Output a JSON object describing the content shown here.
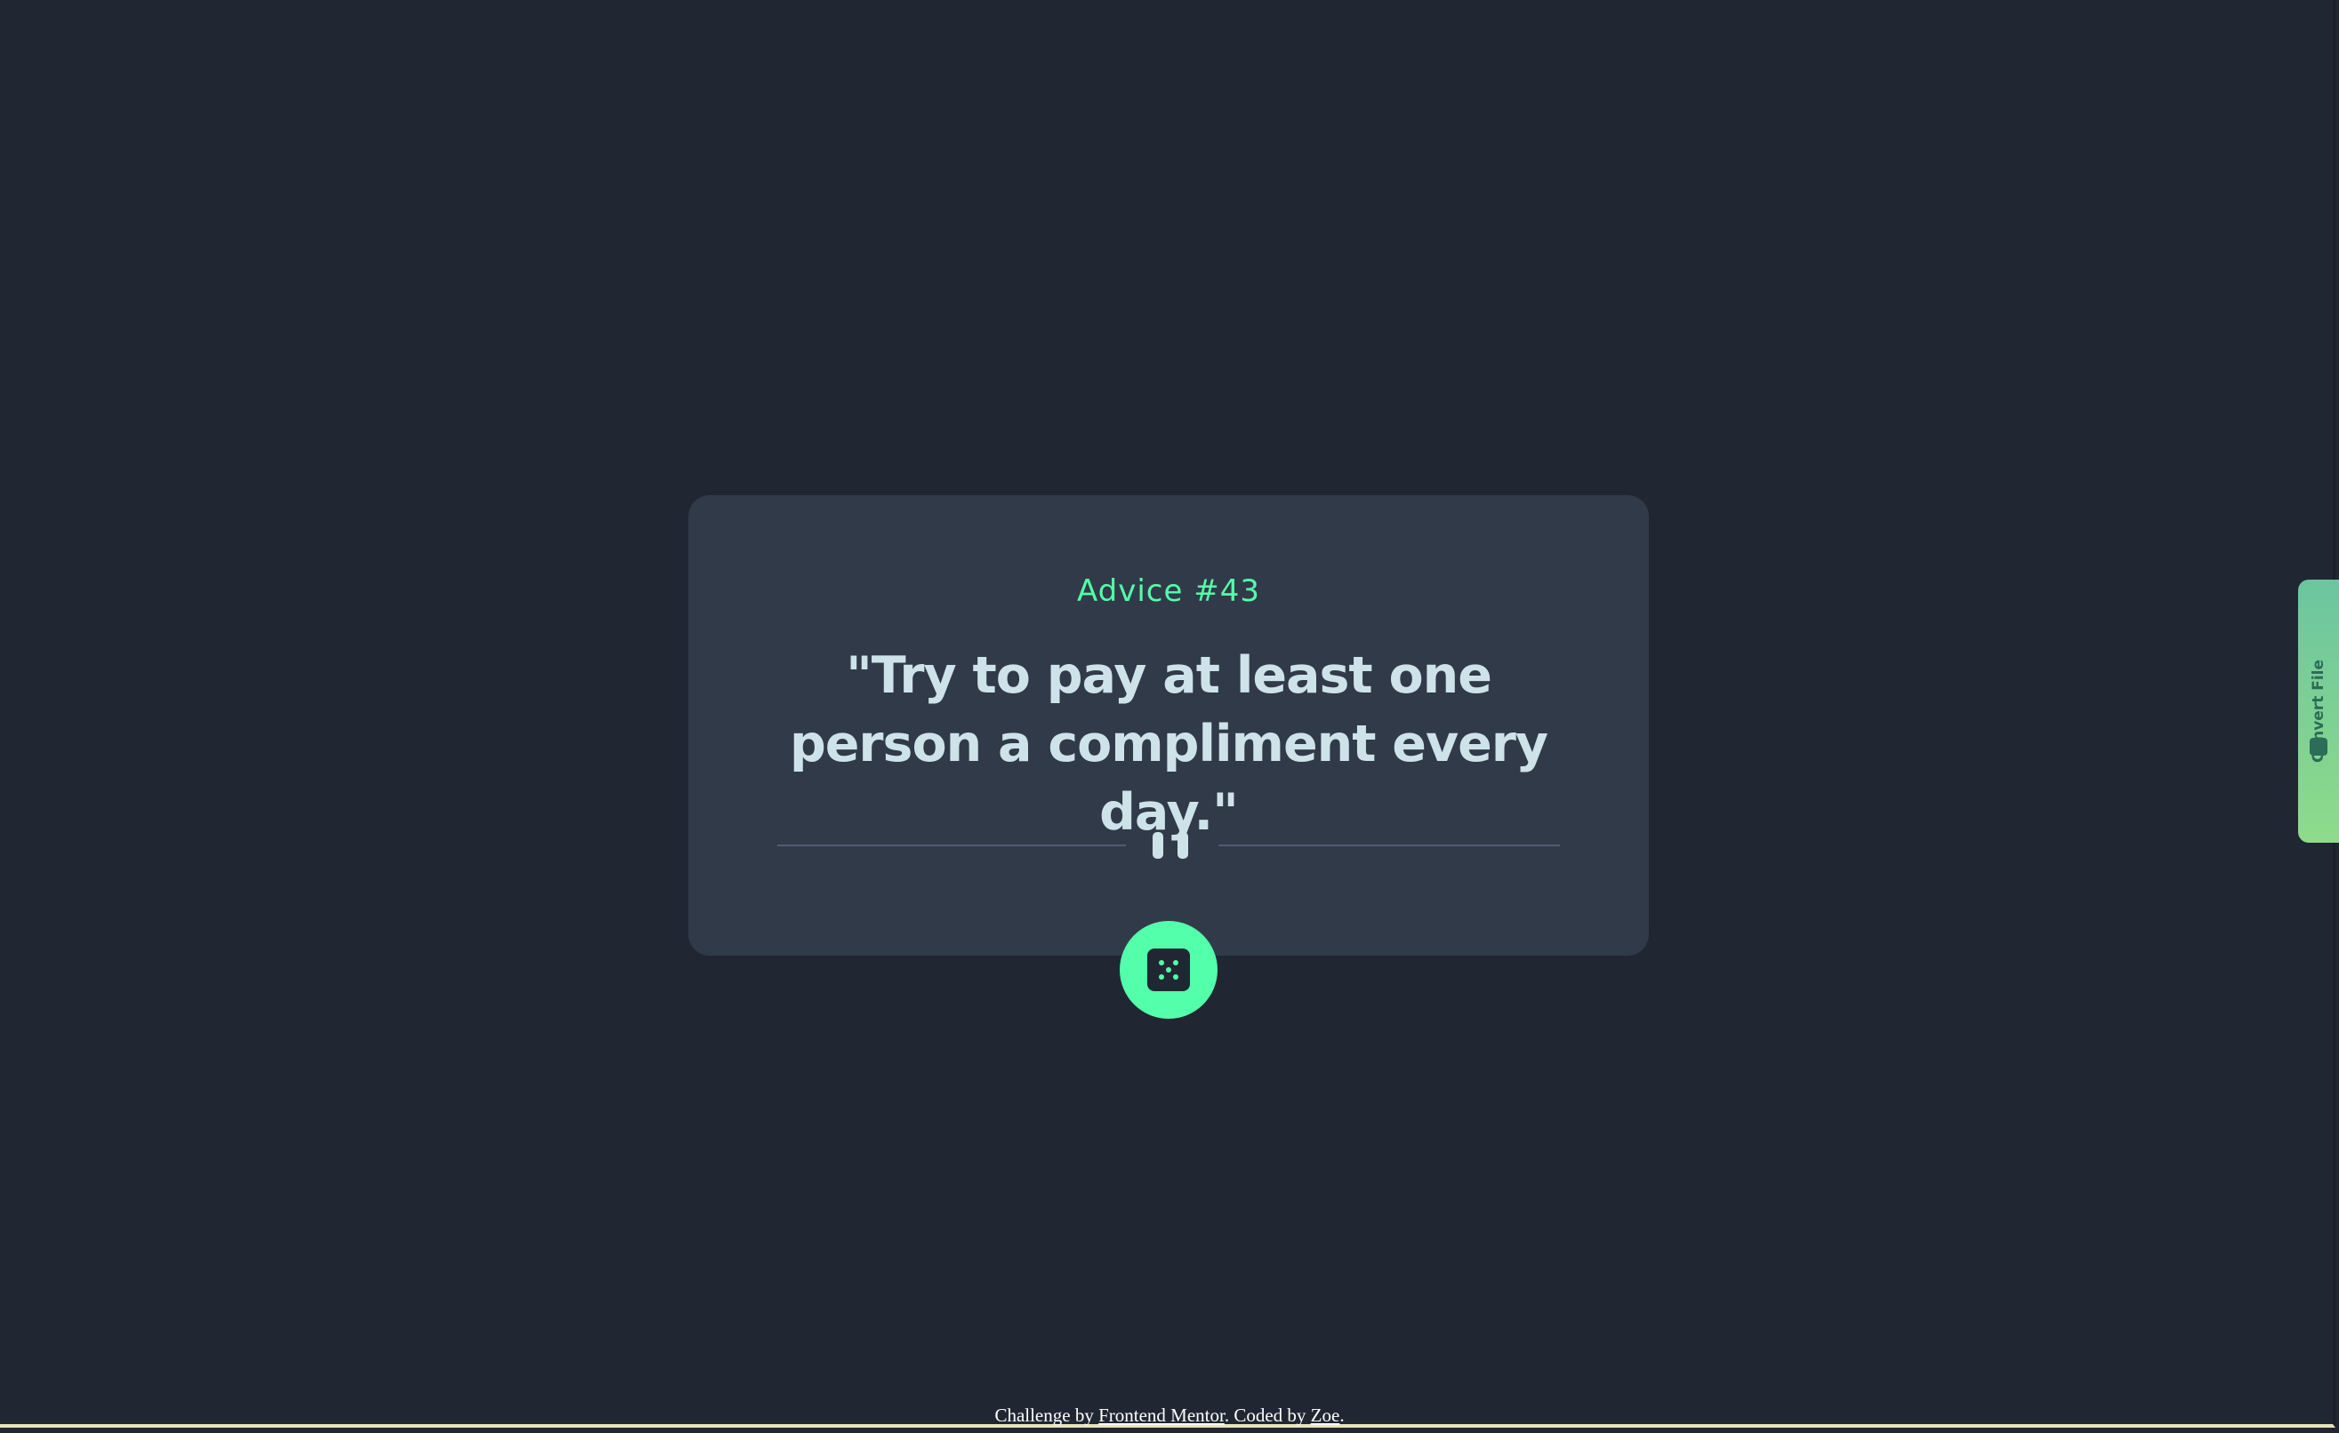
{
  "advice": {
    "label": "Advice #43",
    "quote": "\"Try to pay at least one person a compliment every day.\""
  },
  "controls": {
    "generate_icon": "dice-icon",
    "divider_icon": "pause-icon"
  },
  "sidebar_tab": {
    "label": "Convert File",
    "icon": "convert-file-icon"
  },
  "footer": {
    "prefix": "Challenge by ",
    "link_1": "Frontend Mentor",
    "middle": ". Coded by ",
    "link_2": "Zoe",
    "suffix": "."
  },
  "colors": {
    "background": "#202733",
    "card": "#313a48",
    "accent": "#53ffaa",
    "text": "#cee3e9"
  }
}
